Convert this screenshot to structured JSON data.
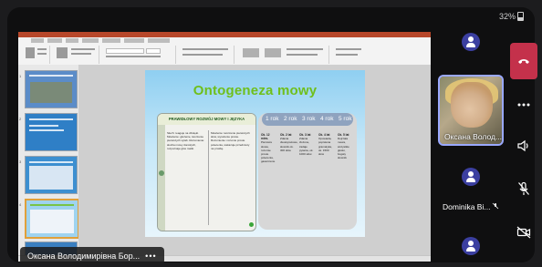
{
  "status_bar": {
    "battery": "32%"
  },
  "shared_screen": {
    "slide": {
      "title": "Ontogeneza mowy",
      "left_panel": {
        "header": "PRAWIDŁOWY ROZWÓJ MOWY I JĘZYKA",
        "col1_text": "Słuch: reaguje na dźwięki. Mówienie: głużenie, tworzenie pierwszych sylab. Rozumienie: słucha mowy dorosłych, rozpoznaje głos matki.",
        "col2_text": "Mówienie: tworzenie pierwszych słów, wyrażenie proste. Rozumienie: rozumie proste polecenia, wskazuje przedmioty na prośbę."
      },
      "right_panel": {
        "years": [
          "1 rok",
          "2 rok",
          "3 rok",
          "4 rok",
          "5 rok"
        ],
        "columns": [
          {
            "head": "Ok. 12 mies.",
            "text": "Pierwsze słowa, rozumie proste polecenia, gaworzenie"
          },
          {
            "head": "Ok. 2 lat",
            "text": "Zdania dwuwyrazowe, słownik ok. 300 słów"
          },
          {
            "head": "Ok. 3 lat",
            "text": "Zdania złożone, zadaje pytania, ok. 1000 słów"
          },
          {
            "head": "Ok. 4 lat",
            "text": "Opowiada, poprawna gramatyka, ok. 1500 słów"
          },
          {
            "head": "Ok. 5 lat",
            "text": "Dojrzała mowa, wszystkie głoski, bogaty słownik"
          }
        ]
      }
    }
  },
  "presenter": {
    "name": "Оксана Володимирівна Бор...",
    "more": "•••"
  },
  "participants": [
    {
      "type": "avatar",
      "label": ""
    },
    {
      "type": "video",
      "label": "Оксана Волод..."
    },
    {
      "type": "avatar",
      "label": "Dominika Bi...",
      "muted": true
    },
    {
      "type": "avatar",
      "label": ""
    }
  ],
  "controls": [
    "hang-up",
    "more",
    "speaker",
    "mic-off",
    "camera-off"
  ],
  "colors": {
    "hangup": "#c4314b",
    "avatar": "#3b3fa0",
    "title_green": "#6fbf1b",
    "ppt_accent": "#b7472a"
  }
}
